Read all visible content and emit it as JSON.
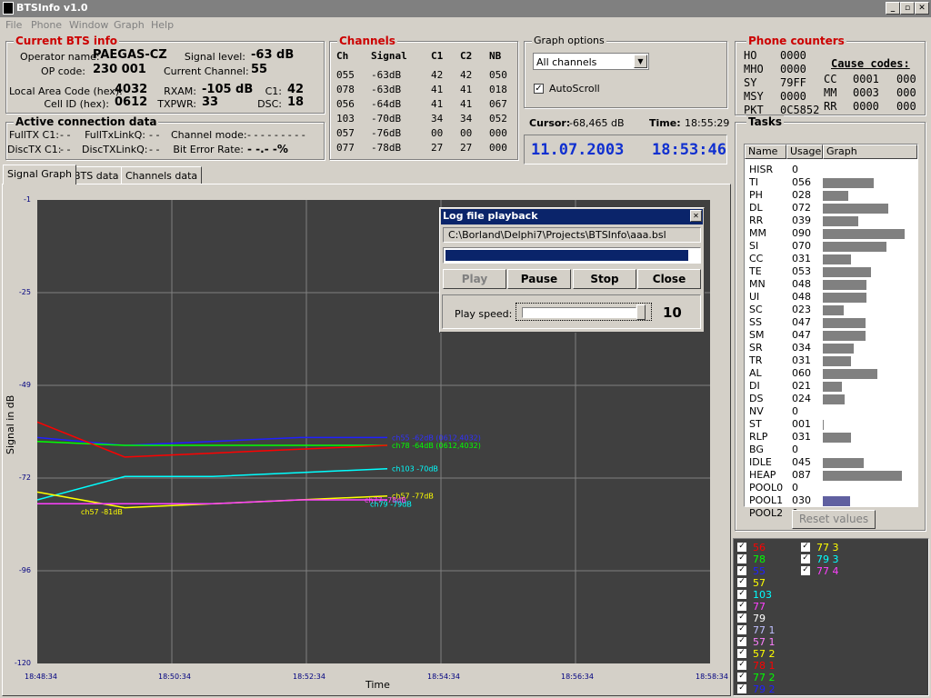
{
  "window": {
    "title": "BTSInfo v1.0",
    "min": "_",
    "max": "▫",
    "close": "✕"
  },
  "menu": [
    "File",
    "Phone",
    "Window",
    "Graph",
    "Help"
  ],
  "bts": {
    "title": "Current BTS info",
    "operator_label": "Operator name:",
    "operator": "PAEGAS-CZ",
    "opcode_label": "OP code:",
    "opcode": "230 001",
    "signal_label": "Signal level:",
    "signal": "-63 dB",
    "channel_label": "Current Channel:",
    "channel": "55",
    "lac_label": "Local Area Code (hex):",
    "lac": "4032",
    "rxam_label": "RXAM:",
    "rxam": "-105 dB",
    "c1_label": "C1:",
    "c1": "42",
    "cellid_label": "Cell ID (hex):",
    "cellid": "0612",
    "txpwr_label": "TXPWR:",
    "txpwr": "33",
    "dsc_label": "DSC:",
    "dsc": "18"
  },
  "conn": {
    "title": "Active connection data",
    "fulltx_label": "FullTX C1:",
    "fulltx": "- -",
    "fulltxlink_label": "FullTxLinkQ:",
    "fulltxlink": "- -",
    "chmode_label": "Channel mode:",
    "chmode": "- - - - - - - - -",
    "disctx_label": "DiscTX C1:",
    "disctx": "- -",
    "disctxlink_label": "DiscTXLinkQ:",
    "disctxlink": "- -",
    "ber_label": "Bit Error Rate:",
    "ber": "- -.- -%"
  },
  "channels": {
    "title": "Channels",
    "headers": [
      "Ch",
      "Signal",
      "C1",
      "C2",
      "NB"
    ],
    "rows": [
      [
        "055",
        "-63dB",
        "42",
        "42",
        "050"
      ],
      [
        "078",
        "-63dB",
        "41",
        "41",
        "018"
      ],
      [
        "056",
        "-64dB",
        "41",
        "41",
        "067"
      ],
      [
        "103",
        "-70dB",
        "34",
        "34",
        "052"
      ],
      [
        "057",
        "-76dB",
        "00",
        "00",
        "000"
      ],
      [
        "077",
        "-78dB",
        "27",
        "27",
        "000"
      ]
    ]
  },
  "graph_options": {
    "title": "Graph options",
    "select": "All channels",
    "autoscroll": "AutoScroll"
  },
  "cursor": {
    "label": "Cursor:",
    "value": "-68,465 dB",
    "time_label": "Time:",
    "time": "18:55:29"
  },
  "datetime": "11.07.2003   18:53:46",
  "phone_counters": {
    "title": "Phone counters",
    "cause_title": "Cause codes:",
    "left": [
      [
        "HO",
        "0000"
      ],
      [
        "MHO",
        "0000"
      ],
      [
        "SY",
        "79FF"
      ],
      [
        "MSY",
        "0000"
      ],
      [
        "PKT",
        "0C5852"
      ]
    ],
    "right": [
      [
        "CC",
        "0001",
        "000"
      ],
      [
        "MM",
        "0003",
        "000"
      ],
      [
        "RR",
        "0000",
        "000"
      ]
    ]
  },
  "tasks": {
    "title": "Tasks",
    "headers": [
      "Name",
      "Usage",
      "Graph"
    ],
    "rows": [
      [
        "HISR",
        "0"
      ],
      [
        "TI",
        "056"
      ],
      [
        "PH",
        "028"
      ],
      [
        "DL",
        "072"
      ],
      [
        "RR",
        "039"
      ],
      [
        "MM",
        "090"
      ],
      [
        "SI",
        "070"
      ],
      [
        "CC",
        "031"
      ],
      [
        "TE",
        "053"
      ],
      [
        "MN",
        "048"
      ],
      [
        "UI",
        "048"
      ],
      [
        "SC",
        "023"
      ],
      [
        "SS",
        "047"
      ],
      [
        "SM",
        "047"
      ],
      [
        "SR",
        "034"
      ],
      [
        "TR",
        "031"
      ],
      [
        "AL",
        "060"
      ],
      [
        "DI",
        "021"
      ],
      [
        "DS",
        "024"
      ],
      [
        "NV",
        "0"
      ],
      [
        "ST",
        "001"
      ],
      [
        "RLP",
        "031"
      ],
      [
        "BG",
        "0"
      ],
      [
        "IDLE",
        "045"
      ],
      [
        "HEAP",
        "087"
      ],
      [
        "POOL0",
        "0"
      ],
      [
        "POOL1",
        "030"
      ],
      [
        "POOL2",
        "0"
      ]
    ],
    "reset": "Reset values"
  },
  "tabs": [
    "Signal Graph",
    "BTS data",
    "Channels data"
  ],
  "chart": {
    "ylabel": "Signal in dB",
    "xlabel": "Time",
    "yticks": [
      "-1",
      "-25",
      "-49",
      "-72",
      "-96",
      "-120"
    ],
    "xticks": [
      "18:48:34",
      "18:50:34",
      "18:52:34",
      "18:54:34",
      "18:56:34",
      "18:58:34"
    ],
    "labels": [
      {
        "text": "ch55 -62dB (0612,4032)",
        "color": "#3030ff"
      },
      {
        "text": "ch78 -64dB (0612,4032)",
        "color": "#00ff00"
      },
      {
        "text": "ch103 -70dB",
        "color": "#00ffff"
      },
      {
        "text": "ch57 -77dB",
        "color": "#ffff00"
      },
      {
        "text": "ch77 -78dB",
        "color": "#ff40ff"
      },
      {
        "text": "ch57 -81dB",
        "color": "#ffff00"
      },
      {
        "text": "ch79 -79dB",
        "color": "#00ffff"
      }
    ]
  },
  "chart_data": {
    "type": "line",
    "xlabel": "Time",
    "ylabel": "Signal in dB",
    "ylim": [
      -120,
      -1
    ],
    "x": [
      "18:48:34",
      "18:50:34",
      "18:52:34",
      "18:54:34",
      "18:56:34",
      "18:58:34"
    ],
    "series": [
      {
        "name": "ch55",
        "color": "#2020ff",
        "values": [
          -62,
          -64,
          -63,
          -62,
          -62
        ]
      },
      {
        "name": "ch78",
        "color": "#00ff00",
        "values": [
          -63,
          -64,
          -64,
          -64,
          -64
        ]
      },
      {
        "name": "ch56",
        "color": "#ff0000",
        "values": [
          -58,
          -67,
          -66,
          -65,
          -64
        ]
      },
      {
        "name": "ch103",
        "color": "#00ffff",
        "values": [
          -78,
          -72,
          -72,
          -71,
          -70
        ]
      },
      {
        "name": "ch57",
        "color": "#ffff00",
        "values": [
          -76,
          -80,
          -79,
          -78,
          -77
        ]
      },
      {
        "name": "ch77",
        "color": "#ff40ff",
        "values": [
          -79,
          -79,
          -79,
          -78,
          -78
        ]
      }
    ]
  },
  "dialog": {
    "title": "Log file playback",
    "path": "C:\\Borland\\Delphi7\\Projects\\BTSInfo\\aaa.bsl",
    "progress": 0.96,
    "buttons": [
      "Play",
      "Pause",
      "Stop",
      "Close"
    ],
    "speed_label": "Play speed:",
    "speed": "10"
  },
  "legend": [
    {
      "label": "56",
      "color": "#ff0000"
    },
    {
      "label": "78",
      "color": "#00ff00"
    },
    {
      "label": "55",
      "color": "#2020ff"
    },
    {
      "label": "57",
      "color": "#ffff00"
    },
    {
      "label": "103",
      "color": "#00ffff"
    },
    {
      "label": "77",
      "color": "#ff40ff"
    },
    {
      "label": "79",
      "color": "#ffffff"
    },
    {
      "label": "77 1",
      "color": "#c0c0ff"
    },
    {
      "label": "57 1",
      "color": "#ff80ff"
    },
    {
      "label": "57 2",
      "color": "#ffff00"
    },
    {
      "label": "78 1",
      "color": "#ff0000"
    },
    {
      "label": "77 2",
      "color": "#00ff00"
    },
    {
      "label": "79 2",
      "color": "#2020ff"
    },
    {
      "label": "77 3",
      "color": "#ffff00"
    },
    {
      "label": "79 3",
      "color": "#00ffff"
    },
    {
      "label": "77 4",
      "color": "#ff40ff"
    }
  ]
}
